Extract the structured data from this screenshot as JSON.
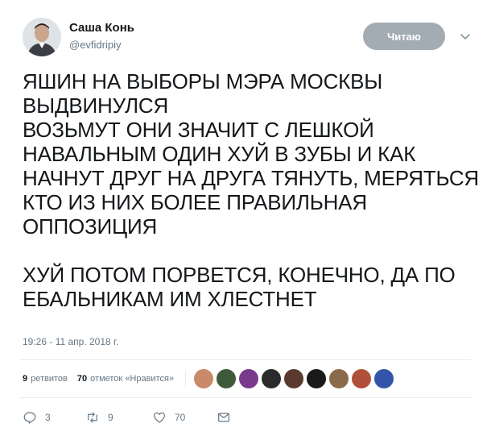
{
  "user": {
    "display_name": "Саша Конь",
    "handle": "@evfidripiy"
  },
  "follow_button": {
    "label": "Читаю"
  },
  "tweet": {
    "text": "ЯШИН НА ВЫБОРЫ МЭРА МОСКВЫ\nВЫДВИНУЛСЯ\nВОЗЬМУТ ОНИ ЗНАЧИТ С ЛЕШКОЙ\nНАВАЛЬНЫМ ОДИН ХУЙ В ЗУБЫ И КАК\nНАЧНУТ ДРУГ НА ДРУГА ТЯНУТЬ, МЕРЯТЬСЯ\nКТО ИЗ НИХ БОЛЕЕ ПРАВИЛЬНАЯ\nОППОЗИЦИЯ\n\nХУЙ ПОТОМ ПОРВЕТСЯ, КОНЕЧНО, ДА ПО\nЕБАЛЬНИКАМ ИМ ХЛЕСТНЕТ",
    "timestamp": "19:26 - 11 апр. 2018 г."
  },
  "stats": {
    "retweets_count": "9",
    "retweets_label": "ретвитов",
    "likes_count": "70",
    "likes_label": "отметок «Нравится»"
  },
  "likers": [
    {
      "name": "liker-avatar-1",
      "color": "#c98a6a"
    },
    {
      "name": "liker-avatar-2",
      "color": "#3f5a3a"
    },
    {
      "name": "liker-avatar-3",
      "color": "#7a3a8c"
    },
    {
      "name": "liker-avatar-4",
      "color": "#2b2b2b"
    },
    {
      "name": "liker-avatar-5",
      "color": "#5a3a2e"
    },
    {
      "name": "liker-avatar-6",
      "color": "#1a1a1a"
    },
    {
      "name": "liker-avatar-7",
      "color": "#8a6a4a"
    },
    {
      "name": "liker-avatar-8",
      "color": "#b0503a"
    },
    {
      "name": "liker-avatar-9",
      "color": "#3355aa"
    }
  ],
  "actions": {
    "reply_count": "3",
    "retweet_count": "9",
    "like_count": "70"
  },
  "colors": {
    "text": "#14171a",
    "secondary": "#657786",
    "follow_button_bg": "#a3abb3",
    "divider": "#e6ecf0"
  }
}
